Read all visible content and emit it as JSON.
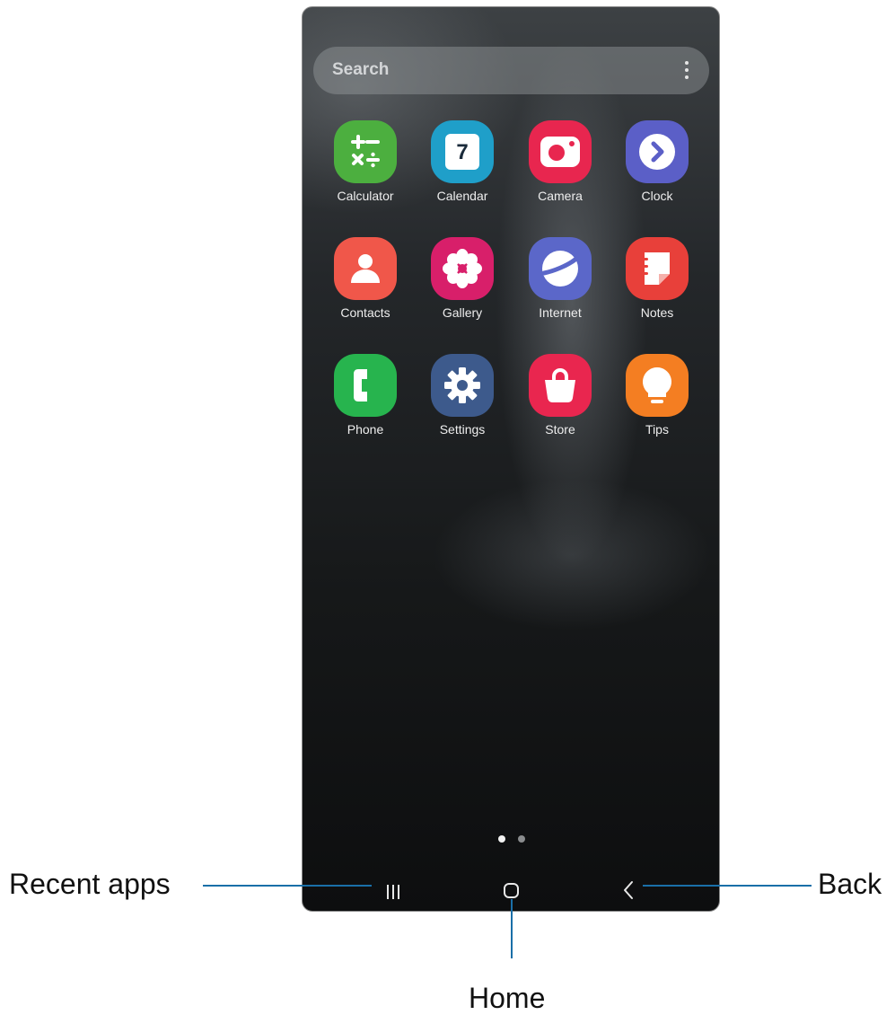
{
  "search": {
    "placeholder": "Search",
    "more_icon": "more-vertical-icon"
  },
  "apps": [
    {
      "label": "Calculator",
      "icon": "calculator-icon",
      "color": "#4caf3f"
    },
    {
      "label": "Calendar",
      "icon": "calendar-icon",
      "color": "#1f9fc9",
      "icon_text": "7"
    },
    {
      "label": "Camera",
      "icon": "camera-icon",
      "color": "#e8264f"
    },
    {
      "label": "Clock",
      "icon": "clock-icon",
      "color": "#5b5fc7"
    },
    {
      "label": "Contacts",
      "icon": "contacts-icon",
      "color": "#f0574a"
    },
    {
      "label": "Gallery",
      "icon": "gallery-icon",
      "color": "#d81f6a"
    },
    {
      "label": "Internet",
      "icon": "internet-icon",
      "color": "#5b67c9"
    },
    {
      "label": "Notes",
      "icon": "notes-icon",
      "color": "#e8403a"
    },
    {
      "label": "Phone",
      "icon": "phone-icon",
      "color": "#27b44e"
    },
    {
      "label": "Settings",
      "icon": "settings-icon",
      "color": "#3d5a8c"
    },
    {
      "label": "Store",
      "icon": "store-icon",
      "color": "#e9264f"
    },
    {
      "label": "Tips",
      "icon": "tips-icon",
      "color": "#f47e22"
    }
  ],
  "page_indicator": {
    "count": 2,
    "active": 1
  },
  "navbar": {
    "recent_icon": "recent-apps-icon",
    "home_icon": "home-icon",
    "back_icon": "back-icon"
  },
  "callouts": {
    "recent": "Recent apps",
    "home": "Home",
    "back": "Back"
  },
  "colors": {
    "callout_line": "#1a6fa8"
  }
}
